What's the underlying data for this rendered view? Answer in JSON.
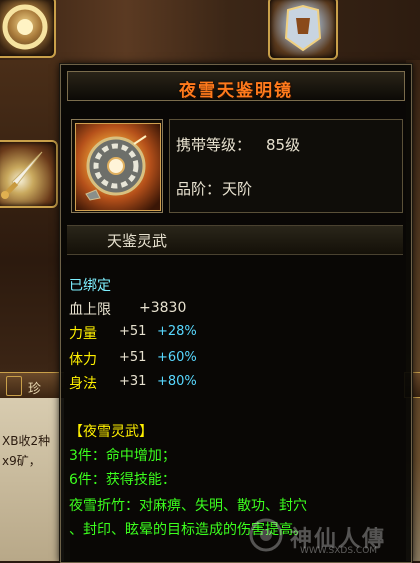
{
  "item": {
    "name": "夜雪天鉴明镜",
    "carry_level_label": "携带等级：",
    "carry_level_value": "85级",
    "grade_label": "品阶：",
    "grade_value": "天阶",
    "category": "天鉴灵武"
  },
  "status": {
    "bound": "已绑定"
  },
  "stats": {
    "hp_label": "血上限",
    "hp_value": "+3830",
    "rows": [
      {
        "name": "力量",
        "base": "+51",
        "pct": "+28%"
      },
      {
        "name": "体力",
        "base": "+51",
        "pct": "+60%"
      },
      {
        "name": "身法",
        "base": "+31",
        "pct": "+80%"
      }
    ]
  },
  "set": {
    "title": "【夜雪灵武】",
    "bonus_3": "3件：命中增加；",
    "bonus_6": "6件：获得技能：",
    "skill_line1": "夜雪折竹：对麻痹、失明、散功、封穴",
    "skill_line2": "、封印、眩晕的目标造成的伤害提高。"
  },
  "background": {
    "tab_text": "珍",
    "chat_lines": [
      "XB收2种",
      "x9矿，"
    ]
  },
  "watermark": {
    "brand": "神仙人傳",
    "url": "WWW.SXDS.COM"
  },
  "colors": {
    "title": "#ff7a1c",
    "stat_name": "#fff000",
    "percent": "#58d8ff",
    "set_text": "#3cff1e",
    "bound": "#7ef0ff"
  },
  "icons": {
    "item": "bronze-mirror-wheel-icon",
    "slot_top_left": "bronze-mirror-icon",
    "slot_top_right": "armor-chest-icon",
    "slot_mid_left": "dagger-icon"
  }
}
